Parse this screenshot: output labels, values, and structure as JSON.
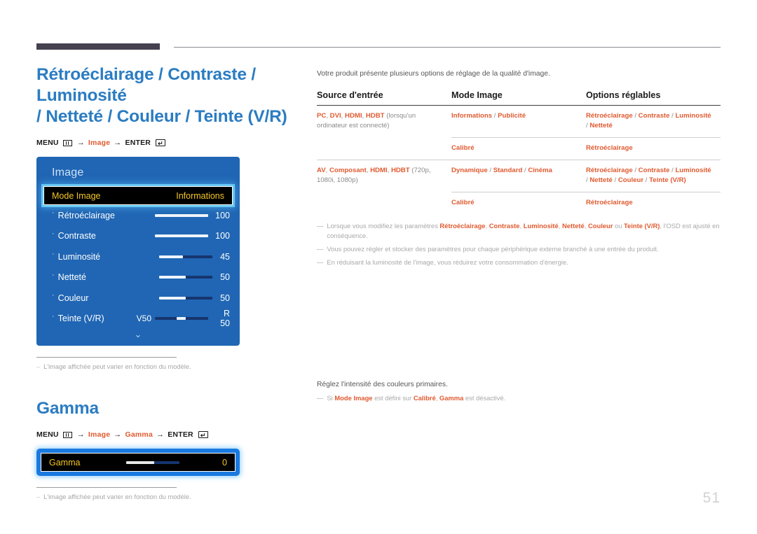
{
  "page": {
    "number": "51"
  },
  "left": {
    "section1": {
      "title_line1": "Rétroéclairage / Contraste / Luminosité",
      "title_line2": "/ Netteté / Couleur / Teinte (V/R)",
      "breadcrumb": {
        "menu_label": "MENU",
        "menu_icon": "menu-grid-icon",
        "arrow1": "→",
        "item1": "Image",
        "arrow2": "→",
        "enter_label": "ENTER",
        "enter_icon": "enter-return-icon"
      },
      "osd": {
        "title": "Image",
        "highlight": {
          "label": "Mode Image",
          "value": "Informations"
        },
        "rows": [
          {
            "label": "Rétroéclairage",
            "prefix": "",
            "value": "100",
            "fill_pct": 100,
            "type": "fill"
          },
          {
            "label": "Contraste",
            "prefix": "",
            "value": "100",
            "fill_pct": 100,
            "type": "fill"
          },
          {
            "label": "Luminosité",
            "prefix": "",
            "value": "45",
            "fill_pct": 45,
            "type": "fill"
          },
          {
            "label": "Netteté",
            "prefix": "",
            "value": "50",
            "fill_pct": 50,
            "type": "fill"
          },
          {
            "label": "Couleur",
            "prefix": "",
            "value": "50",
            "fill_pct": 50,
            "type": "fill"
          },
          {
            "label": "Teinte (V/R)",
            "prefix": "V50",
            "value": "R 50",
            "fill_pct": 50,
            "type": "knob"
          }
        ],
        "chevron": "⌄"
      },
      "note": "L'image affichée peut varier en fonction du modèle.",
      "note_dash": "–"
    },
    "section2": {
      "title": "Gamma",
      "breadcrumb": {
        "menu_label": "MENU",
        "menu_icon": "menu-grid-icon",
        "arrow1": "→",
        "item1": "Image",
        "arrow2": "→",
        "item2": "Gamma",
        "arrow3": "→",
        "enter_label": "ENTER",
        "enter_icon": "enter-return-icon"
      },
      "osd": {
        "label": "Gamma",
        "value": "0",
        "fill_pct": 52
      },
      "note": "L'image affichée peut varier en fonction du modèle.",
      "note_dash": "–"
    }
  },
  "right": {
    "intro": "Votre produit présente plusieurs options de réglage de la qualité d'image.",
    "table": {
      "headers": [
        "Source d'entrée",
        "Mode Image",
        "Options réglables"
      ],
      "rows": [
        {
          "source_orange": "PC, DVI, HDMI, HDBT",
          "source_gray": " (lorsqu'un ordinateur est connecté)",
          "mode": "Informations / Publicité",
          "options": "Rétroéclairage / Contraste / Luminosité / Netteté",
          "separator": false
        },
        {
          "source_orange": "",
          "source_gray": "",
          "mode": "Calibré",
          "options": "Rétroéclairage",
          "separator": true
        },
        {
          "source_orange": "AV, Composant, HDMI, HDBT",
          "source_gray": " (720p, 1080i, 1080p)",
          "mode": "Dynamique / Standard / Cinéma",
          "options": "Rétroéclairage / Contraste / Luminosité / Netteté / Couleur / Teinte (V/R)",
          "separator": true
        },
        {
          "source_orange": "",
          "source_gray": "",
          "mode": "Calibré",
          "options": "Rétroéclairage",
          "separator": true
        }
      ]
    },
    "bullets": [
      {
        "dash": "—",
        "pre": "Lorsque vous modifiez les paramètres ",
        "bold1": "Rétroéclairage",
        "s1": ", ",
        "bold2": "Contraste",
        "s2": ", ",
        "bold3": "Luminosité",
        "s3": ", ",
        "bold4": "Netteté",
        "s4": ", ",
        "bold5": "Couleur",
        "s5": " ou ",
        "bold6": "Teinte (V/R)",
        "post": ", l'OSD est ajusté en conséquence."
      },
      {
        "dash": "—",
        "text": "Vous pouvez régler et stocker des paramètres pour chaque périphérique externe branché à une entrée du produit."
      },
      {
        "dash": "—",
        "text": "En réduisant la luminosité de l'image, vous réduirez votre consommation d'énergie."
      }
    ],
    "gamma_section": {
      "intro": "Réglez l'intensité des couleurs primaires.",
      "note_dash": "—",
      "note_pre": "Si ",
      "note_bold1": "Mode Image",
      "note_mid1": " est défini sur ",
      "note_bold2": "Calibré",
      "note_mid2": ", ",
      "note_bold3": "Gamma",
      "note_post": " est désactivé."
    }
  },
  "colors": {
    "heading_blue": "#2b7cc2",
    "accent_orange": "#e05a30",
    "osd_blue": "#2066b4",
    "osd_yellow": "#f5c623",
    "rule_dark": "#45414f"
  }
}
